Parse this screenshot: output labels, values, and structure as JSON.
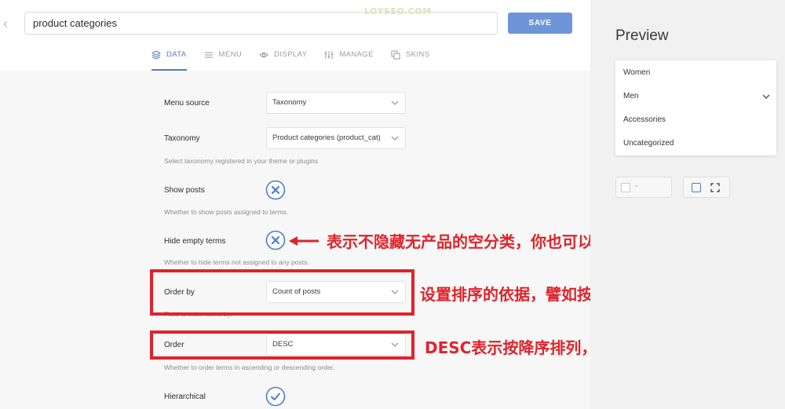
{
  "header": {
    "back_icon": "chevron-left-icon",
    "title_value": "product categories",
    "save_label": "SAVE",
    "watermark": "LOYSEO.COM"
  },
  "tabs": [
    {
      "label": "DATA",
      "icon": "layers-icon",
      "active": true
    },
    {
      "label": "MENU",
      "icon": "menu-icon",
      "active": false
    },
    {
      "label": "DISPLAY",
      "icon": "eye-icon",
      "active": false
    },
    {
      "label": "MANAGE",
      "icon": "sliders-icon",
      "active": false
    },
    {
      "label": "SKINS",
      "icon": "copy-icon",
      "active": false
    }
  ],
  "settings": {
    "menu_source": {
      "label": "Menu source",
      "value": "Taxonomy"
    },
    "taxonomy": {
      "label": "Taxonomy",
      "value": "Product categories (product_cat)",
      "help": "Select taxonomy registered in your theme or plugins"
    },
    "show_posts": {
      "label": "Show posts",
      "help": "Whether to show posts assigned to terms.",
      "checked": false
    },
    "hide_empty": {
      "label": "Hide empty terms",
      "help": "Whether to hide terms not assigned to any posts.",
      "checked": false
    },
    "order_by": {
      "label": "Order by",
      "value": "Count of posts",
      "help": "Field to order terms by."
    },
    "order": {
      "label": "Order",
      "value": "DESC",
      "help": "Whether to order terms in ascending or descending order."
    },
    "hierarchical": {
      "label": "Hierarchical",
      "checked": true
    }
  },
  "annotations": {
    "hide_empty_note": "表示不隐藏无产品的空分类，你也可以设置为隐藏",
    "order_by_note": "设置排序的依据，譬如按照产品数量排列",
    "order_note": "DESC表示按降序排列，反之亦然"
  },
  "preview": {
    "title": "Preview",
    "items": [
      "Women",
      "Men",
      "Accessories",
      "Uncategorized"
    ],
    "color_value": "-"
  },
  "colors": {
    "accent": "#4f7cc8",
    "save_button": "#6f95d9",
    "annotation_red": "#e0232b"
  }
}
